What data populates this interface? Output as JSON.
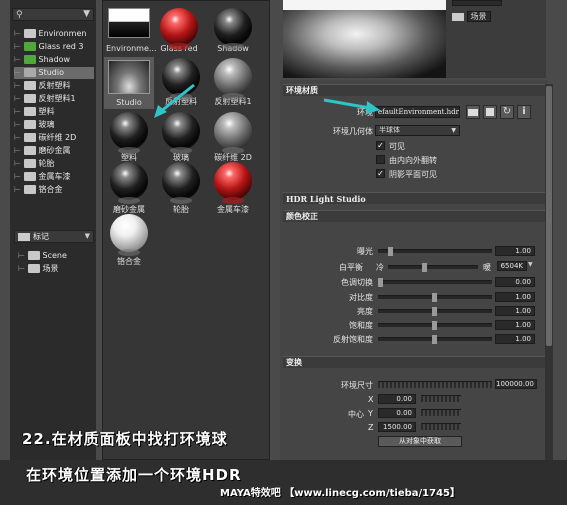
{
  "outliner": {
    "filter_placeholder": "",
    "items": [
      {
        "label": "Environmen",
        "icon": "sphere-icon"
      },
      {
        "label": "Glass red 3",
        "icon": "material-icon"
      },
      {
        "label": "Shadow",
        "icon": "material-icon"
      },
      {
        "label": "Studio",
        "icon": "studio-icon"
      },
      {
        "label": "反射塑料",
        "icon": "material-icon"
      },
      {
        "label": "反射塑料1",
        "icon": "material-icon"
      },
      {
        "label": "塑料",
        "icon": "material-icon"
      },
      {
        "label": "玻璃",
        "icon": "material-icon"
      },
      {
        "label": "碳纤维 2D",
        "icon": "material-icon"
      },
      {
        "label": "磨砂金属",
        "icon": "material-icon"
      },
      {
        "label": "轮胎",
        "icon": "material-icon"
      },
      {
        "label": "金属车漆",
        "icon": "material-icon"
      },
      {
        "label": "铬合金",
        "icon": "material-icon"
      }
    ],
    "dropdown_label": "标记",
    "scene_items": [
      {
        "label": "Scene"
      },
      {
        "label": "场景"
      }
    ]
  },
  "materials": [
    {
      "label": "Environme...",
      "style": "env"
    },
    {
      "label": "Glass red ...",
      "style": "red"
    },
    {
      "label": "Shadow",
      "style": "black"
    },
    {
      "label": "Studio",
      "style": "studio"
    },
    {
      "label": "反射塑料",
      "style": "black"
    },
    {
      "label": "反射塑料1",
      "style": "grey"
    },
    {
      "label": "塑料",
      "style": "black"
    },
    {
      "label": "玻璃",
      "style": "black"
    },
    {
      "label": "碳纤维 2D",
      "style": "grey"
    },
    {
      "label": "磨砂金属",
      "style": "black"
    },
    {
      "label": "轮胎",
      "style": "black"
    },
    {
      "label": "金属车漆",
      "style": "red"
    },
    {
      "label": "铬合金",
      "style": "white"
    }
  ],
  "header": {
    "tag_label": "场景"
  },
  "env_material": {
    "title": "环境材质",
    "env_label": "环境",
    "env_value": "efaultEnvironment.hdr",
    "geometry_label": "环境几何体",
    "geometry_value": "半球体",
    "visible_label": "可见",
    "flip_label": "由内向外翻转",
    "shadow_label": "阴影平面可见"
  },
  "hdr_section": "HDR Light Studio",
  "color_correction": {
    "title": "颜色校正",
    "exposure": {
      "label": "曝光",
      "value": "1.00"
    },
    "white_balance": {
      "label": "白平衡",
      "cold": "冷",
      "warm": "暖",
      "value": "6504K"
    },
    "hue": {
      "label": "色调切换",
      "value": "0.00"
    },
    "contrast": {
      "label": "对比度",
      "value": "1.00"
    },
    "brightness": {
      "label": "亮度",
      "value": "1.00"
    },
    "saturation": {
      "label": "饱和度",
      "value": "1.00"
    },
    "refl_saturation": {
      "label": "反射饱和度",
      "value": "1.00"
    }
  },
  "transform": {
    "title": "变换",
    "size": {
      "label": "环境尺寸",
      "value": "100000.00"
    },
    "x": {
      "label": "X",
      "value": "0.00"
    },
    "center_label": "中心",
    "y": {
      "label": "Y",
      "value": "0.00"
    },
    "z": {
      "label": "Z",
      "value": "1500.00"
    },
    "from_object_button": "从对象中获取"
  },
  "captions": {
    "line1": "22.在材质面板中找打环境球",
    "line2": "在环境位置添加一个环境HDR",
    "watermark": "MAYA特效吧 【www.linecg.com/tieba/1745】"
  },
  "colors": {
    "annotation_arrow": "#2fc4c8"
  }
}
